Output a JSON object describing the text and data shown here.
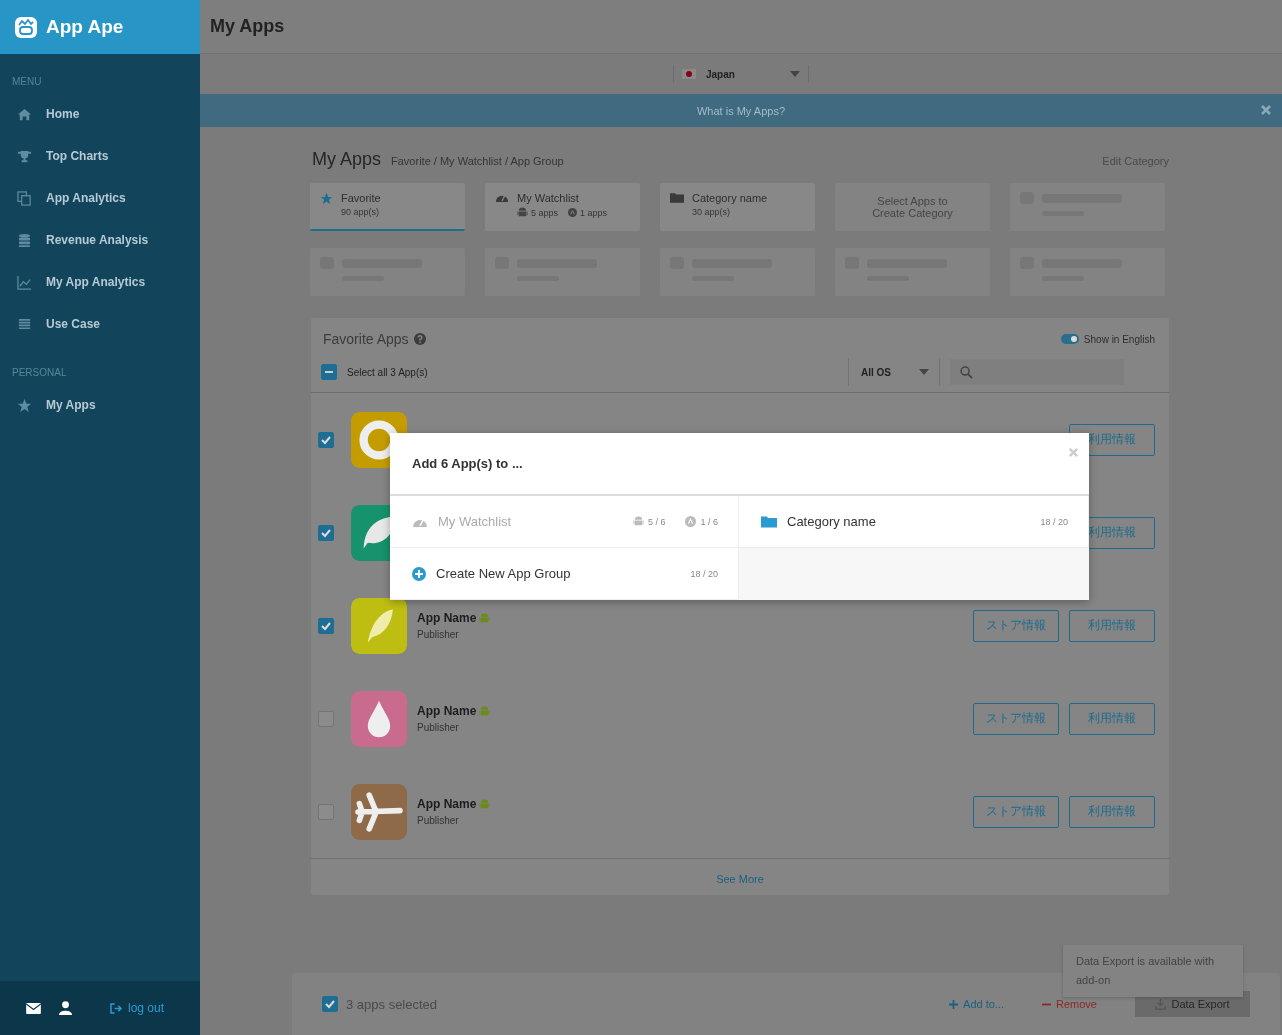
{
  "sidebar": {
    "brand": "App Ape",
    "sections": [
      {
        "heading": "MENU",
        "items": [
          {
            "kind": "home",
            "label": "Home"
          },
          {
            "kind": "trophy",
            "label": "Top Charts"
          },
          {
            "kind": "copy",
            "label": "App Analytics"
          },
          {
            "kind": "database",
            "label": "Revenue Analysis"
          },
          {
            "kind": "chart",
            "label": "My App Analytics"
          },
          {
            "kind": "list",
            "label": "Use Case"
          }
        ]
      },
      {
        "heading": "PERSONAL",
        "items": [
          {
            "kind": "star",
            "label": "My Apps"
          }
        ]
      }
    ],
    "logout": "log out"
  },
  "header": {
    "title": "My Apps"
  },
  "country": {
    "value": "Japan"
  },
  "info_bar": {
    "text": "What is My Apps?"
  },
  "page": {
    "title": "My Apps",
    "breadcrumb": "Favorite / My Watchlist / App Group",
    "edit": "Edit Category"
  },
  "groups": [
    {
      "kind": "favorite",
      "title": "Favorite",
      "subtitle": "90 app(s)",
      "selected": true
    },
    {
      "kind": "watchlist",
      "title": "My Watchlist",
      "android": "5 apps",
      "ios": "1 apps",
      "selected": false
    },
    {
      "kind": "category",
      "title": "Category name",
      "subtitle": "30 app(s)",
      "selected": false
    },
    {
      "kind": "create",
      "title": "Select Apps to Create Category"
    },
    {
      "kind": "skeleton"
    },
    {
      "kind": "skeleton"
    },
    {
      "kind": "skeleton"
    },
    {
      "kind": "skeleton"
    },
    {
      "kind": "skeleton"
    },
    {
      "kind": "skeleton"
    }
  ],
  "list": {
    "title": "Favorite Apps",
    "english": {
      "label": "Show in English",
      "on": true
    },
    "select_all": {
      "label": "Select all 3 App(s)",
      "indeterminate": true
    },
    "os_filter": "All OS",
    "rows": [
      {
        "kind": "lifebuoy",
        "color": "#c59c00",
        "checked": true,
        "buttons": [
          "利用情報"
        ]
      },
      {
        "kind": "leaf",
        "color": "#16926c",
        "checked": true,
        "buttons": [
          "利用情報"
        ]
      },
      {
        "kind": "feather",
        "color": "#bdbd12",
        "checked": true,
        "name": "App Name",
        "publisher": "Publisher",
        "buttons": [
          "ストア情報",
          "利用情報"
        ]
      },
      {
        "kind": "drop",
        "color": "#c96a8f",
        "checked": false,
        "name": "App Name",
        "publisher": "Publisher",
        "buttons": [
          "ストア情報",
          "利用情報"
        ]
      },
      {
        "kind": "plane",
        "color": "#8e6a48",
        "checked": false,
        "name": "App Name",
        "publisher": "Publisher",
        "buttons": [
          "ストア情報",
          "利用情報"
        ]
      }
    ],
    "see_more": "See More"
  },
  "bottom_bar": {
    "selected": "3 apps selected",
    "checked": true,
    "add": "Add to...",
    "remove": "Remove",
    "export": "Data Export",
    "tooltip": "Data Export is available with add-on"
  },
  "modal": {
    "title": "Add 6 App(s) to ...",
    "options": [
      {
        "kind": "watchlist",
        "label": "My Watchlist",
        "disabled": true,
        "android": "5 / 6",
        "ios": "1 / 6"
      },
      {
        "kind": "category",
        "label": "Category name",
        "disabled": false,
        "count": "18 / 20"
      },
      {
        "kind": "create",
        "label": "Create New App Group",
        "disabled": false,
        "count": "18 / 20"
      }
    ]
  }
}
